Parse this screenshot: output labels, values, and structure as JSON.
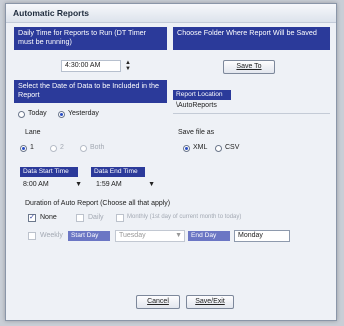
{
  "window": {
    "title": "Automatic Reports"
  },
  "daily_time": {
    "header": "Daily Time for Reports to Run (DT Timer must be running)",
    "value": "4:30:00 AM"
  },
  "folder": {
    "header": "Choose Folder Where Report Will be Saved",
    "save_to_label": "Save To",
    "location_tag": "Report Location",
    "location_value": "\\AutoReports"
  },
  "date_select": {
    "header": "Select the Date of Data to be Included in the Report",
    "today_label": "Today",
    "yesterday_label": "Yesterday",
    "selected": "Yesterday"
  },
  "lane": {
    "label": "Lane",
    "options": [
      "1",
      "2",
      "Both"
    ],
    "selected": "1"
  },
  "save_file": {
    "label": "Save file as",
    "xml_label": "XML",
    "csv_label": "CSV",
    "selected": "XML"
  },
  "times": {
    "start_tag": "Data Start Time",
    "end_tag": "Data End Time",
    "start_value": "8:00 AM",
    "end_value": "1:59 AM"
  },
  "duration": {
    "label": "Duration of Auto Report (Choose all that apply)",
    "none_label": "None",
    "daily_label": "Daily",
    "monthly_label": "Monthly (1st day of current month to today)",
    "weekly_label": "Weekly",
    "start_day_tag": "Start Day",
    "start_day_value": "Tuesday",
    "end_day_tag": "End Day",
    "end_day_value": "Monday",
    "none_checked": "✓"
  },
  "footer": {
    "cancel_label": "Cancel",
    "save_exit_label": "Save/Exit"
  }
}
